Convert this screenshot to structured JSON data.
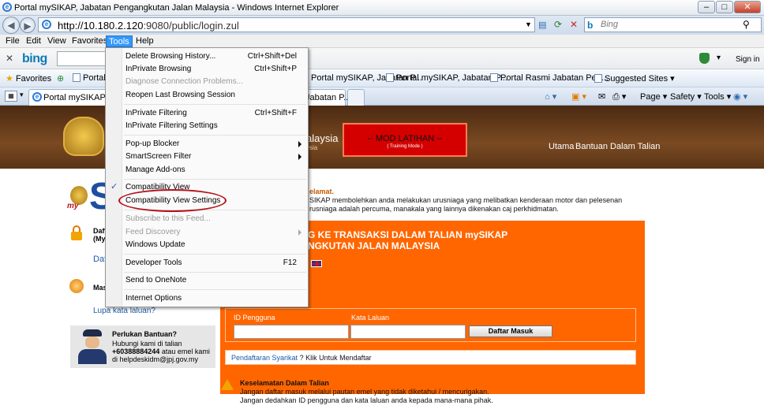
{
  "window": {
    "title": "Portal mySIKAP, Jabatan Pengangkutan Jalan Malaysia - Windows Internet Explorer"
  },
  "address": {
    "url_host": "http://10.180.2.120",
    "url_rest": ":9080/public/login.zul"
  },
  "search": {
    "placeholder": "Bing"
  },
  "menubar": {
    "items": [
      "File",
      "Edit",
      "View",
      "Favorites",
      "Tools",
      "Help"
    ]
  },
  "bingbar": {
    "logo": "bing",
    "signin": "Sign in"
  },
  "favorites": {
    "label": "Favorites",
    "items": [
      "Portal",
      "Portal mySIKAP, Jabatan P...",
      "Portal mySIKAP, Jabatan P...",
      "Portal Rasmi Jabatan Pen...",
      "Suggested Sites ▾"
    ]
  },
  "tabs": {
    "active": "Portal mySIKAP, Jab",
    "second": "Jabatan P..."
  },
  "commandbar": {
    "page": "Page ▾",
    "safety": "Safety ▾",
    "tools": "Tools ▾"
  },
  "tools_menu": {
    "items": [
      {
        "label": "Delete Browsing History...",
        "shortcut": "Ctrl+Shift+Del"
      },
      {
        "label": "InPrivate Browsing",
        "shortcut": "Ctrl+Shift+P"
      },
      {
        "label": "Diagnose Connection Problems...",
        "shortcut": ""
      },
      {
        "label": "Reopen Last Browsing Session",
        "shortcut": ""
      },
      {
        "label": "InPrivate Filtering",
        "shortcut": "Ctrl+Shift+F"
      },
      {
        "label": "InPrivate Filtering Settings",
        "shortcut": ""
      },
      {
        "label": "Pop-up Blocker",
        "shortcut": ""
      },
      {
        "label": "SmartScreen Filter",
        "shortcut": ""
      },
      {
        "label": "Manage Add-ons",
        "shortcut": ""
      },
      {
        "label": "Compatibility View",
        "shortcut": ""
      },
      {
        "label": "Compatibility View Settings",
        "shortcut": ""
      },
      {
        "label": "Subscribe to this Feed...",
        "shortcut": ""
      },
      {
        "label": "Feed Discovery",
        "shortcut": ""
      },
      {
        "label": "Windows Update",
        "shortcut": ""
      },
      {
        "label": "Developer Tools",
        "shortcut": "F12"
      },
      {
        "label": "Send to OneNote",
        "shortcut": ""
      },
      {
        "label": "Internet Options",
        "shortcut": ""
      }
    ]
  },
  "header": {
    "site_name": "alaysia",
    "site_sub": "ysia",
    "mod_title": "-- MOD LATIHAN --",
    "mod_sub": "( Training Mode )",
    "nav_home": "Utama",
    "nav_help": "Bantuan Dalam Talian"
  },
  "left": {
    "logo_text": "S",
    "logo_sub": "my",
    "item1_a": "Daft",
    "item1_b": "(My",
    "item1_link": "Daft",
    "item2": "Mas",
    "forgot": "Lupa kata laluan?"
  },
  "helpbox": {
    "title": "Perlukan Bantuan?",
    "line1": "Hubungi kami di talian",
    "line2a": "+60388884244",
    "line2b": " atau emel kami",
    "line3": "di helpdeskidm@jpj.gov.my"
  },
  "welcome": {
    "head": "elamat.",
    "line1": "SIKAP membolehkan anda melakukan urusniaga yang melibatkan kenderaan motor dan pelesenan",
    "line2": "rusniaga adalah percuma, manakala yang lainnya dikenakan caj perkhidmatan."
  },
  "login": {
    "heading1": "G KE TRANSAKSI DALAM TALIAN mySIKAP",
    "heading2": "NGKUTAN JALAN MALAYSIA",
    "id_label": "ID Pengguna",
    "pw_label": "Kata Laluan",
    "button": "Daftar Masuk",
    "reg_link": "Pendaftaran Syarikat",
    "reg_text": " ? Klik Untuk Mendaftar"
  },
  "security": {
    "title": "Keselamatan Dalam Talian",
    "line1": "Jangan daftar masuk melalui pautan emel yang tidak diketahui / mencurigakan.",
    "line2": "Jangan dedahkan ID pengguna dan kata laluan anda kepada mana-mana pihak."
  }
}
